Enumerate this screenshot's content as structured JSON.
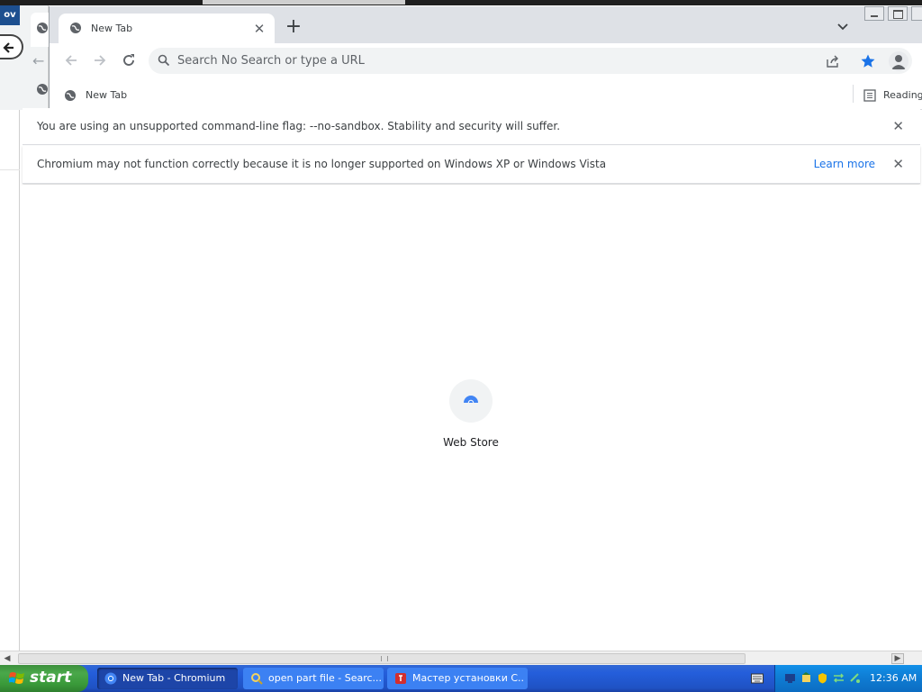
{
  "background": {
    "logo_text": "ov"
  },
  "browser": {
    "tab": {
      "title": "New Tab",
      "close_symbol": "✕"
    },
    "new_tab_symbol": "+",
    "omnibox": {
      "placeholder": "Search No Search or type a URL",
      "value": ""
    },
    "bookmarks": {
      "items": [
        {
          "label": "New Tab",
          "icon": "globe-icon"
        }
      ],
      "reading_list_label": "Reading list"
    },
    "accent_color": "#1a73e8"
  },
  "infobars": [
    {
      "message": "You are using an unsupported command-line flag: --no-sandbox. Stability and security will suffer.",
      "close_symbol": "✕"
    },
    {
      "message": "Chromium may not function correctly because it is no longer supported on Windows XP or Windows Vista",
      "link": "Learn more",
      "close_symbol": "✕"
    }
  ],
  "page": {
    "shortcuts": [
      {
        "label": "Web Store",
        "icon": "web-store-icon"
      }
    ]
  },
  "taskbar": {
    "start_label": "start",
    "tasks": [
      {
        "label": "New Tab - Chromium",
        "icon": "chromium-icon",
        "active": true
      },
      {
        "label": "open part file - Searc...",
        "icon": "search-app-icon",
        "active": false
      },
      {
        "label": "Мастер установки С...",
        "icon": "installer-icon",
        "active": false
      }
    ],
    "clock": "12:36 AM"
  }
}
